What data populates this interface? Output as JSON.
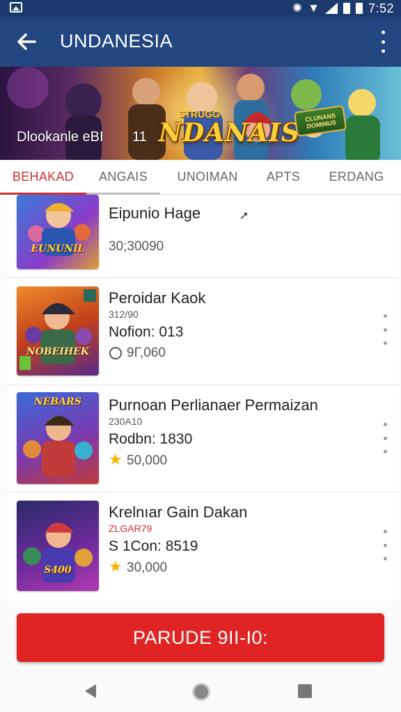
{
  "status_bar": {
    "time": "7:52"
  },
  "app_bar": {
    "title": "UNDANESIA"
  },
  "banner": {
    "caption": "Dlookanle eBI",
    "number": "11",
    "logo_text": "NDANAIS",
    "logo_small": "STRUGG",
    "sign_text": "CLUNANS DOMINUS"
  },
  "tabs": [
    {
      "label": "BEHAKAD",
      "active": true
    },
    {
      "label": "ANGAIS",
      "active": false
    },
    {
      "label": "UNOIMAN",
      "active": false
    },
    {
      "label": "APTS",
      "active": false
    },
    {
      "label": "ERDANG",
      "active": false
    }
  ],
  "games": [
    {
      "title": "Eipunio Hage",
      "subtitle": "",
      "line": "",
      "price": "30;30090",
      "price_icon": "none",
      "thumb_label": "EUNUNIL"
    },
    {
      "title": "Peroidar Kaok",
      "subtitle": "312/90",
      "line": "Nofion: 013",
      "price": "9Γ,060",
      "price_icon": "circle-icon",
      "thumb_label": "NOBEIHEK"
    },
    {
      "title": "Purnoan Perlianaer Permaizan",
      "subtitle": "230A10",
      "line": "Rodbn: 1830",
      "price": "50,000",
      "price_icon": "star-icon",
      "thumb_label": "NEBARS"
    },
    {
      "title": "Krelnıar Gain Dakan",
      "subtitle": "ZLGAR79",
      "line": "S 1Con: 8519",
      "price": "30,000",
      "price_icon": "star-icon",
      "thumb_label": "S400"
    }
  ],
  "cta": {
    "label": "PARUDE 9II-I0:"
  },
  "colors": {
    "app_bar": "#224680",
    "accent": "#d32f2f",
    "cta": "#e02424",
    "star": "#f5b400"
  }
}
